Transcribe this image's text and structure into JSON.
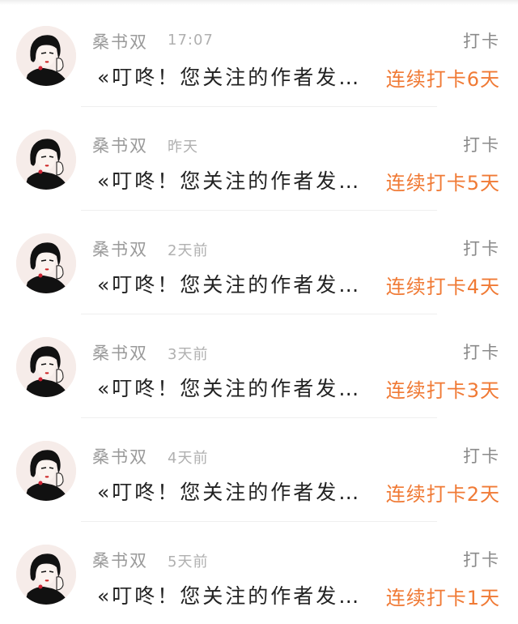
{
  "notifications": [
    {
      "name": "桑书双",
      "time": "17:07",
      "action": "打卡",
      "message": "«叮咚！您关注的作者发…",
      "streak": "连续打卡6天"
    },
    {
      "name": "桑书双",
      "time": "昨天",
      "action": "打卡",
      "message": "«叮咚！您关注的作者发…",
      "streak": "连续打卡5天"
    },
    {
      "name": "桑书双",
      "time": "2天前",
      "action": "打卡",
      "message": "«叮咚！您关注的作者发…",
      "streak": "连续打卡4天"
    },
    {
      "name": "桑书双",
      "time": "3天前",
      "action": "打卡",
      "message": "«叮咚！您关注的作者发…",
      "streak": "连续打卡3天"
    },
    {
      "name": "桑书双",
      "time": "4天前",
      "action": "打卡",
      "message": "«叮咚！您关注的作者发…",
      "streak": "连续打卡2天"
    },
    {
      "name": "桑书双",
      "time": "5天前",
      "action": "打卡",
      "message": "«叮咚！您关注的作者发…",
      "streak": "连续打卡1天"
    }
  ],
  "colors": {
    "streak": "#f07a35",
    "name": "#9a9a9a",
    "message": "#222222"
  }
}
